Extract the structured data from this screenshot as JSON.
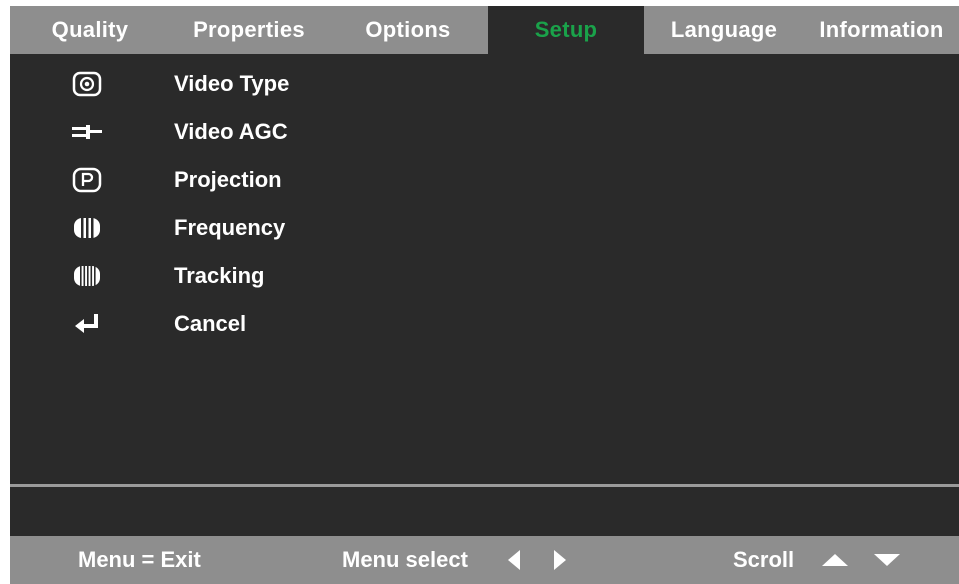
{
  "tabs": [
    {
      "label": "Quality",
      "active": false
    },
    {
      "label": "Properties",
      "active": false
    },
    {
      "label": "Options",
      "active": false
    },
    {
      "label": "Setup",
      "active": true
    },
    {
      "label": "Language",
      "active": false
    },
    {
      "label": "Information",
      "active": false
    }
  ],
  "menu_items": [
    {
      "label": "Video Type",
      "icon": "video-type-icon"
    },
    {
      "label": "Video AGC",
      "icon": "video-agc-icon"
    },
    {
      "label": "Projection",
      "icon": "projection-icon"
    },
    {
      "label": "Frequency",
      "icon": "frequency-icon"
    },
    {
      "label": "Tracking",
      "icon": "tracking-icon"
    },
    {
      "label": "Cancel",
      "icon": "return-arrow-icon"
    }
  ],
  "footer": {
    "menu_exit": "Menu = Exit",
    "menu_select": "Menu select",
    "scroll": "Scroll"
  },
  "colors": {
    "background": "#2a2a2a",
    "bar": "#8e8e8e",
    "active_tab_text": "#1aa24a",
    "text": "#ffffff"
  }
}
